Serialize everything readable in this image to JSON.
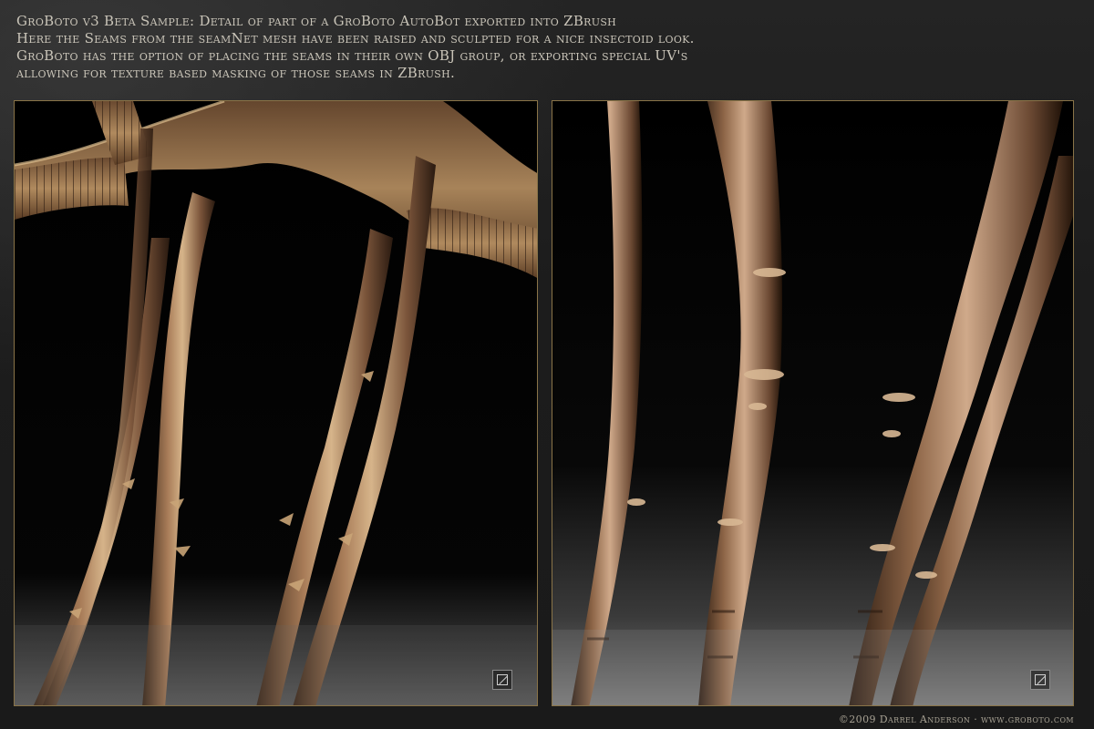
{
  "header": {
    "line1": "GroBoto v3 Beta Sample: Detail of part of a GroBoto AutoBot exported into ZBrush",
    "line2": "Here the Seams from the seamNet mesh have been raised and sculpted for a nice insectoid look.",
    "line3": "GroBoto has the option of placing the seams in their own OBJ group, or exporting special UV's",
    "line4": "allowing for texture based masking of those seams in ZBrush."
  },
  "panels": {
    "left": {
      "logo_icon": "groboto-logo-icon"
    },
    "right": {
      "logo_icon": "groboto-logo-icon"
    }
  },
  "footer": {
    "credit": "©2009 Darrel Anderson · www.groboto.com"
  },
  "colors": {
    "background": "#1e1e1e",
    "panel_border": "#8a7448",
    "header_text": "#c9c4b8",
    "metal_highlight": "#d6b48a",
    "metal_mid": "#8c6446",
    "metal_shadow": "#3a2618"
  }
}
